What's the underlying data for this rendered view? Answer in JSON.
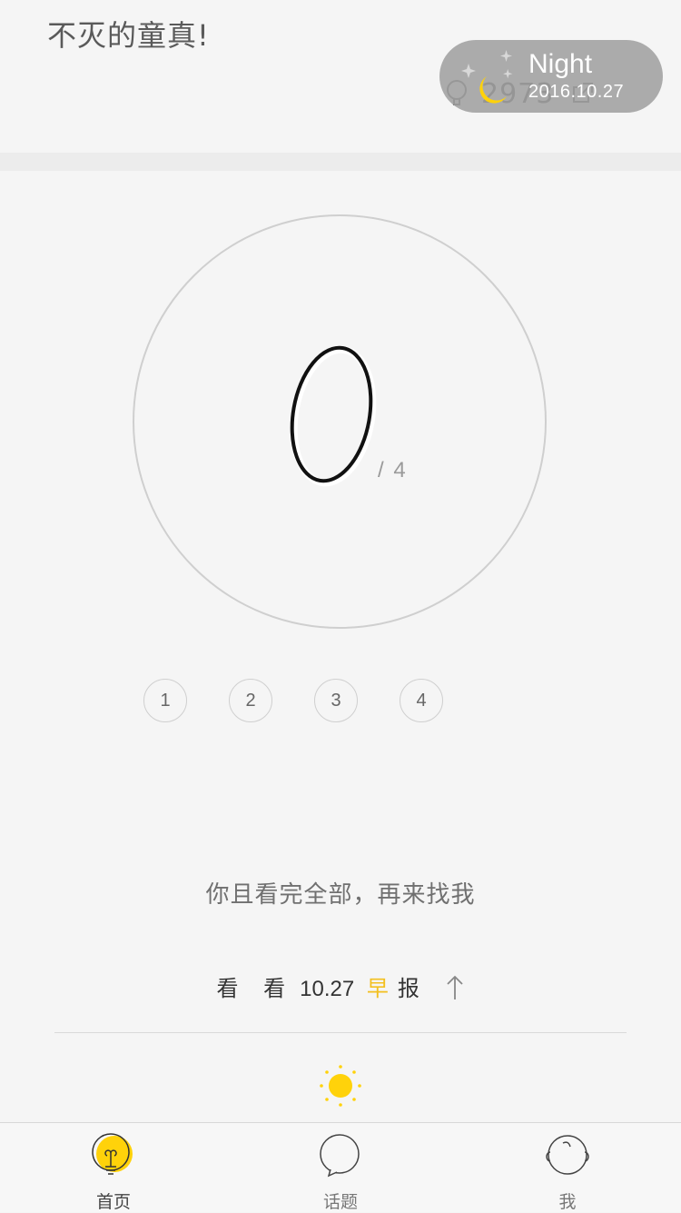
{
  "top": {
    "quote": "不灭的童真!",
    "count": "2973",
    "night": {
      "title": "Night",
      "date": "2016.10.27"
    }
  },
  "quiz": {
    "current": "0",
    "total": "/ 4",
    "pages": [
      "1",
      "2",
      "3",
      "4"
    ]
  },
  "message": "你且看完全部，再来找我",
  "morning": {
    "pre": "看 看",
    "date": "10.27",
    "highlight": "早",
    "post": "报"
  },
  "tabs": [
    {
      "label": "首页",
      "icon": "lightbulb-icon",
      "active": true
    },
    {
      "label": "话题",
      "icon": "speech-bubble-icon",
      "active": false
    },
    {
      "label": "我",
      "icon": "face-icon",
      "active": false
    }
  ],
  "colors": {
    "accent": "#ffd20a",
    "highlight": "#f3c020",
    "pill": "#a0a0a0",
    "background": "#f5f5f5"
  }
}
